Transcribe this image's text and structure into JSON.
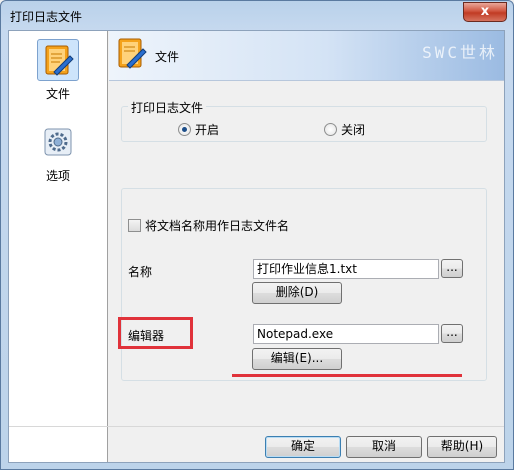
{
  "window": {
    "title": "打印日志文件",
    "close_label": "x"
  },
  "sidebar": {
    "items": [
      {
        "label": "文件",
        "icon": "notebook-pen-icon",
        "selected": true
      },
      {
        "label": "选项",
        "icon": "settings-gear-icon",
        "selected": false
      }
    ]
  },
  "header": {
    "title": "文件",
    "watermark": "SWC世林"
  },
  "log_group": {
    "legend": "打印日志文件",
    "on_label": "开启",
    "off_label": "关闭",
    "selected": "on"
  },
  "options": {
    "use_doc_name_label": "将文档名称用作日志文件名",
    "name_label": "名称",
    "name_value": "打印作业信息1.txt",
    "browse_label": "...",
    "delete_label": "删除(D)",
    "editor_label": "编辑器",
    "editor_value": "Notepad.exe",
    "edit_label": "编辑(E)..."
  },
  "footer": {
    "ok_label": "确定",
    "cancel_label": "取消",
    "help_label": "帮助(H)"
  },
  "colors": {
    "highlight": "#e0323a",
    "accent_blue": "#cde4fb"
  }
}
